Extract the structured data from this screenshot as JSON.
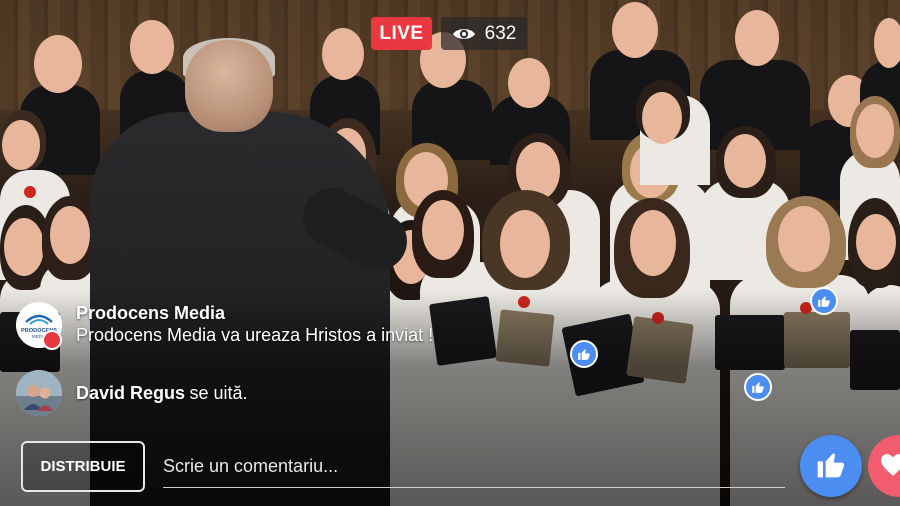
{
  "stream": {
    "live_label": "LIVE",
    "viewer_count": "632",
    "viewer_icon": "eye-icon"
  },
  "comments": [
    {
      "author": "Prodocens Media",
      "message": "Prodocens Media va ureaza Hristos a inviat !",
      "avatar_text": "PRODOCENS MEDIA"
    },
    {
      "author": "David Regus",
      "message": "se uită."
    }
  ],
  "bottom_bar": {
    "share_label": "DISTRIBUIE",
    "comment_placeholder": "Scrie un comentariu...",
    "like_icon": "thumbs-up-icon",
    "love_icon": "heart-icon"
  },
  "colors": {
    "live": "#e9383f",
    "like": "#4b8df0",
    "love": "#f15c6e"
  }
}
